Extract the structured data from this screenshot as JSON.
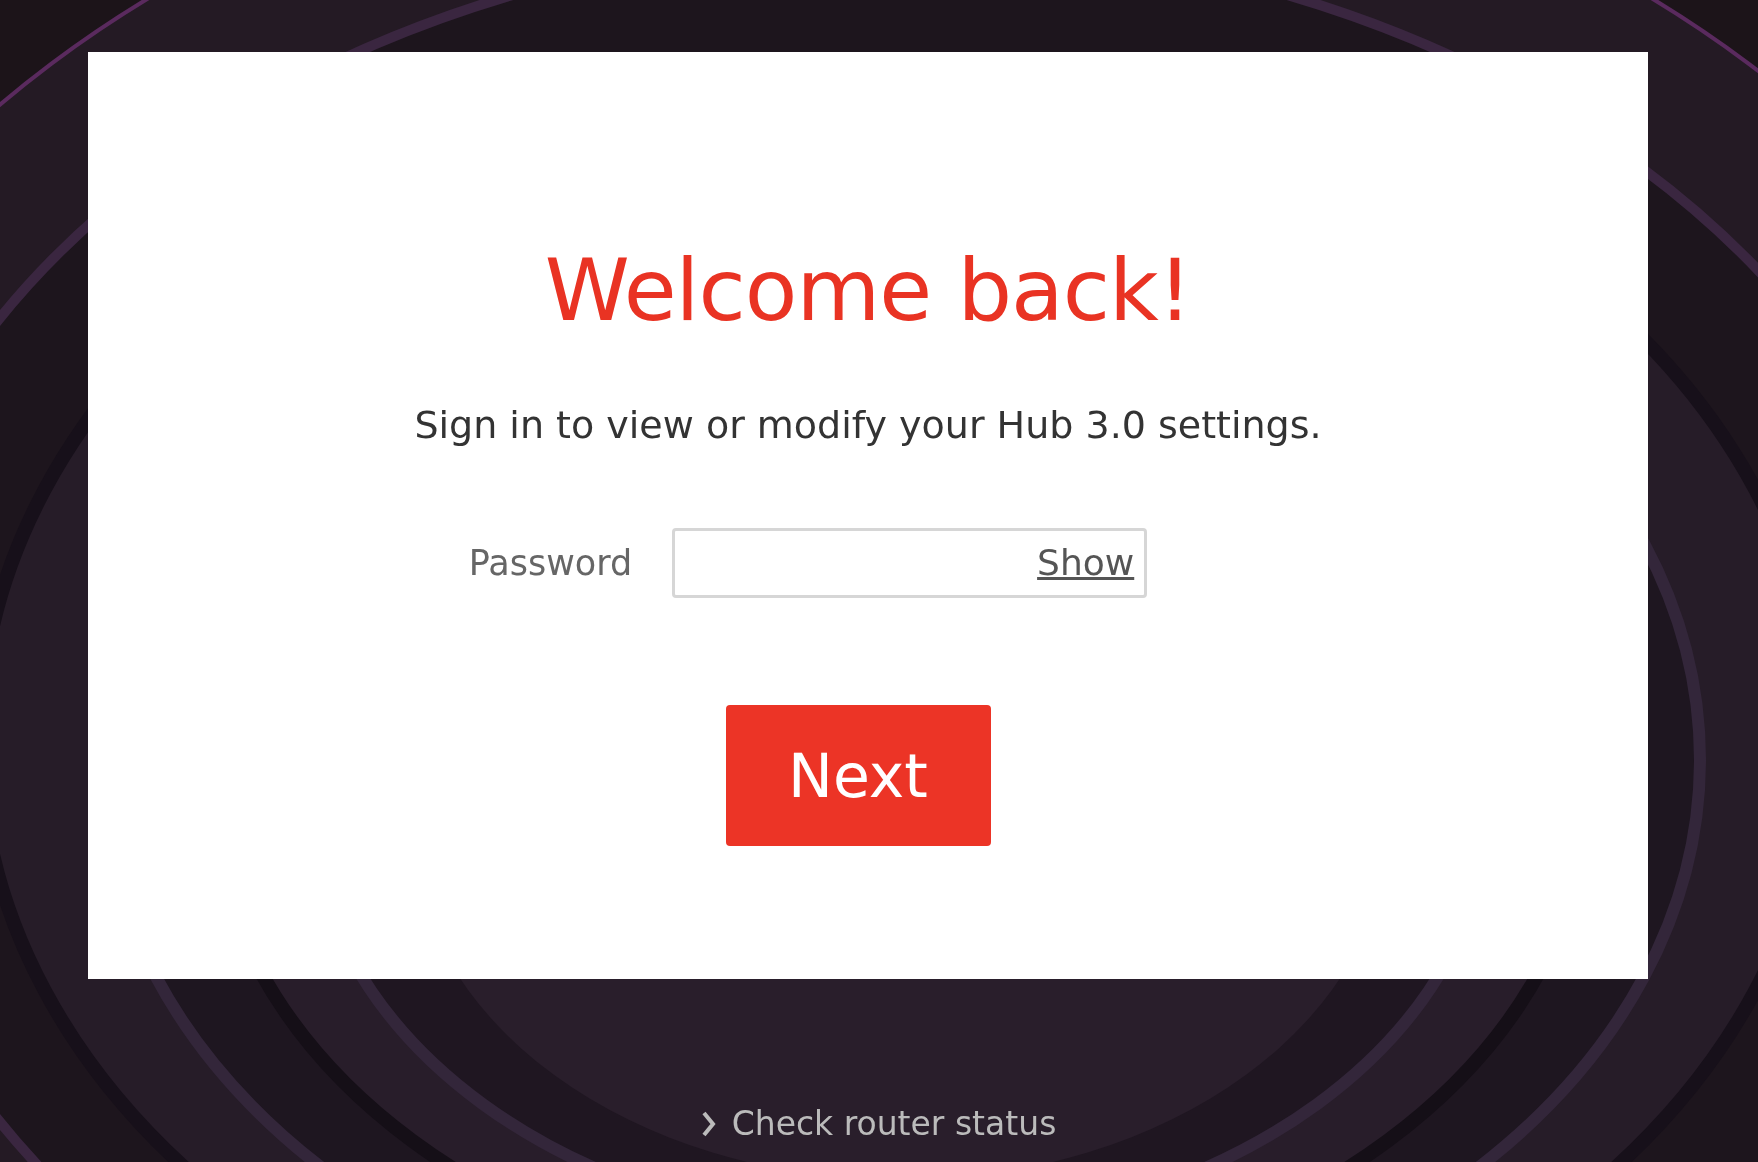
{
  "title": "Welcome back!",
  "subtitle": "Sign in to view or modify your Hub 3.0 settings.",
  "password": {
    "label": "Password",
    "toggle": "Show"
  },
  "button": "Next",
  "footer_link": "Check router status"
}
